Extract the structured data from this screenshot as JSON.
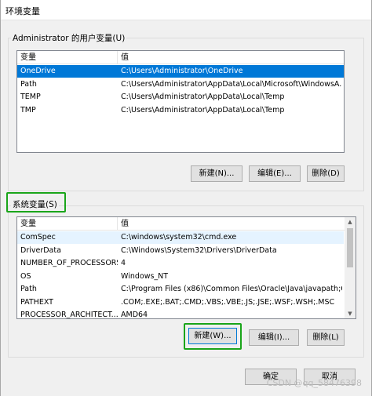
{
  "window": {
    "title": "环境变量"
  },
  "user_vars": {
    "label": "Administrator 的用户变量(U)",
    "columns": [
      "变量",
      "值"
    ],
    "rows": [
      {
        "name": "OneDrive",
        "value": "C:\\Users\\Administrator\\OneDrive",
        "selected": true
      },
      {
        "name": "Path",
        "value": "C:\\Users\\Administrator\\AppData\\Local\\Microsoft\\WindowsA..."
      },
      {
        "name": "TEMP",
        "value": "C:\\Users\\Administrator\\AppData\\Local\\Temp"
      },
      {
        "name": "TMP",
        "value": "C:\\Users\\Administrator\\AppData\\Local\\Temp"
      }
    ],
    "buttons": {
      "new": "新建(N)...",
      "edit": "编辑(E)...",
      "delete": "删除(D)"
    }
  },
  "system_vars": {
    "label": "系统变量(S)",
    "columns": [
      "变量",
      "值"
    ],
    "rows": [
      {
        "name": "ComSpec",
        "value": "C:\\windows\\system32\\cmd.exe",
        "hover": true
      },
      {
        "name": "DriverData",
        "value": "C:\\Windows\\System32\\Drivers\\DriverData"
      },
      {
        "name": "NUMBER_OF_PROCESSORS",
        "value": "4"
      },
      {
        "name": "OS",
        "value": "Windows_NT"
      },
      {
        "name": "Path",
        "value": "C:\\Program Files (x86)\\Common Files\\Oracle\\Java\\javapath;C:..."
      },
      {
        "name": "PATHEXT",
        "value": ".COM;.EXE;.BAT;.CMD;.VBS;.VBE;.JS;.JSE;.WSF;.WSH;.MSC"
      },
      {
        "name": "PROCESSOR_ARCHITECT...",
        "value": "AMD64"
      }
    ],
    "buttons": {
      "new": "新建(W)...",
      "edit": "编辑(I)...",
      "delete": "删除(L)"
    }
  },
  "footer": {
    "ok": "确定",
    "cancel": "取消"
  },
  "watermark": "CSDN @qq_58476398"
}
